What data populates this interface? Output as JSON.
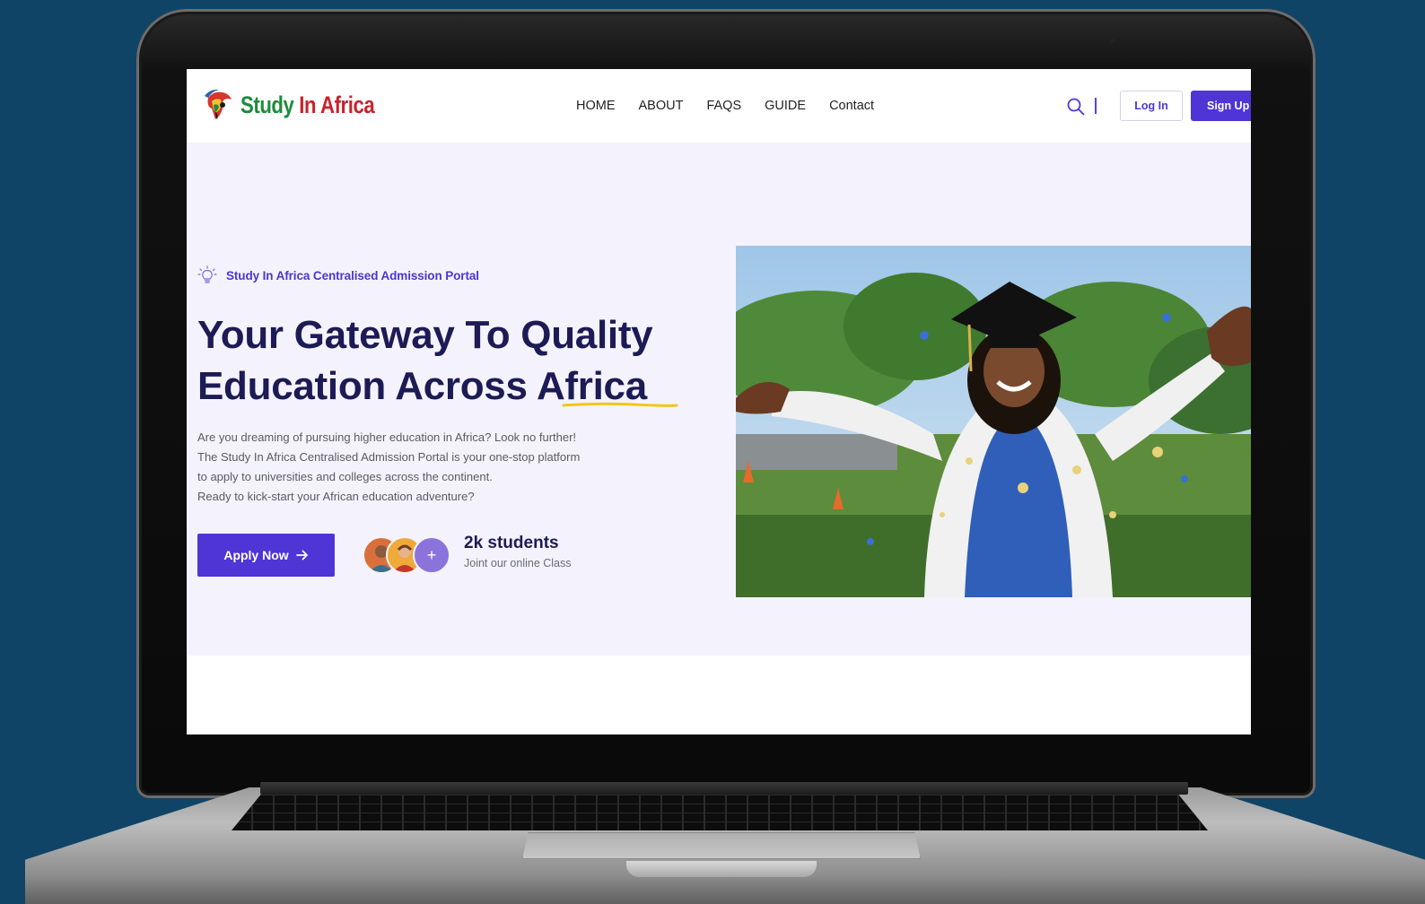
{
  "brand": {
    "name_part1": "Study",
    "name_part2": "In Africa",
    "colors": {
      "green": "#1f8a3b",
      "red": "#c8232c",
      "accent": "#4f35d6",
      "navy": "#1d1b55"
    }
  },
  "nav": {
    "items": [
      "HOME",
      "ABOUT",
      "FAQS",
      "GUIDE",
      "Contact"
    ],
    "login_label": "Log In",
    "signup_label": "Sign Up"
  },
  "hero": {
    "tagline": "Study In Africa Centralised Admission Portal",
    "headline_line1": "Your Gateway To Quality",
    "headline_line2": "Education Across Africa",
    "description": "Are you dreaming of pursuing higher education in Africa? Look no further! The Study In Africa Centralised Admission Portal is your one-stop platform to apply to universities and colleges across the continent.",
    "cta_question": "Ready to kick-start your African education adventure?",
    "apply_label": "Apply Now",
    "students_count": "2k students",
    "students_sub": "Joint our online Class"
  },
  "icons": [
    "logo-africa-icon",
    "search-icon",
    "lightbulb-icon",
    "arrow-right-icon",
    "plus-icon",
    "avatar-icons"
  ]
}
